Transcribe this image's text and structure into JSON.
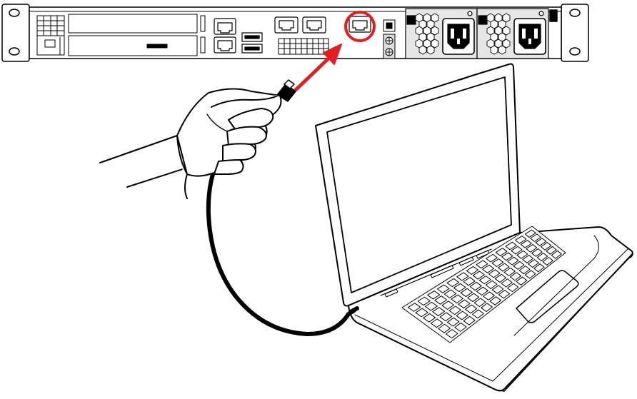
{
  "diagram": {
    "highlighted_port": "management-ethernet-port",
    "colors": {
      "line": "#000000",
      "fill": "#ffffff",
      "accent": "#e41e20",
      "panel_grey": "#d9d9d9"
    },
    "icons": [
      "server-rear-panel-icon",
      "ethernet-port-icon",
      "usb-port-icon",
      "power-supply-icon",
      "power-inlet-icon",
      "hand-icon",
      "network-cable-icon",
      "laptop-icon",
      "arrow-icon",
      "highlight-circle-icon"
    ]
  }
}
